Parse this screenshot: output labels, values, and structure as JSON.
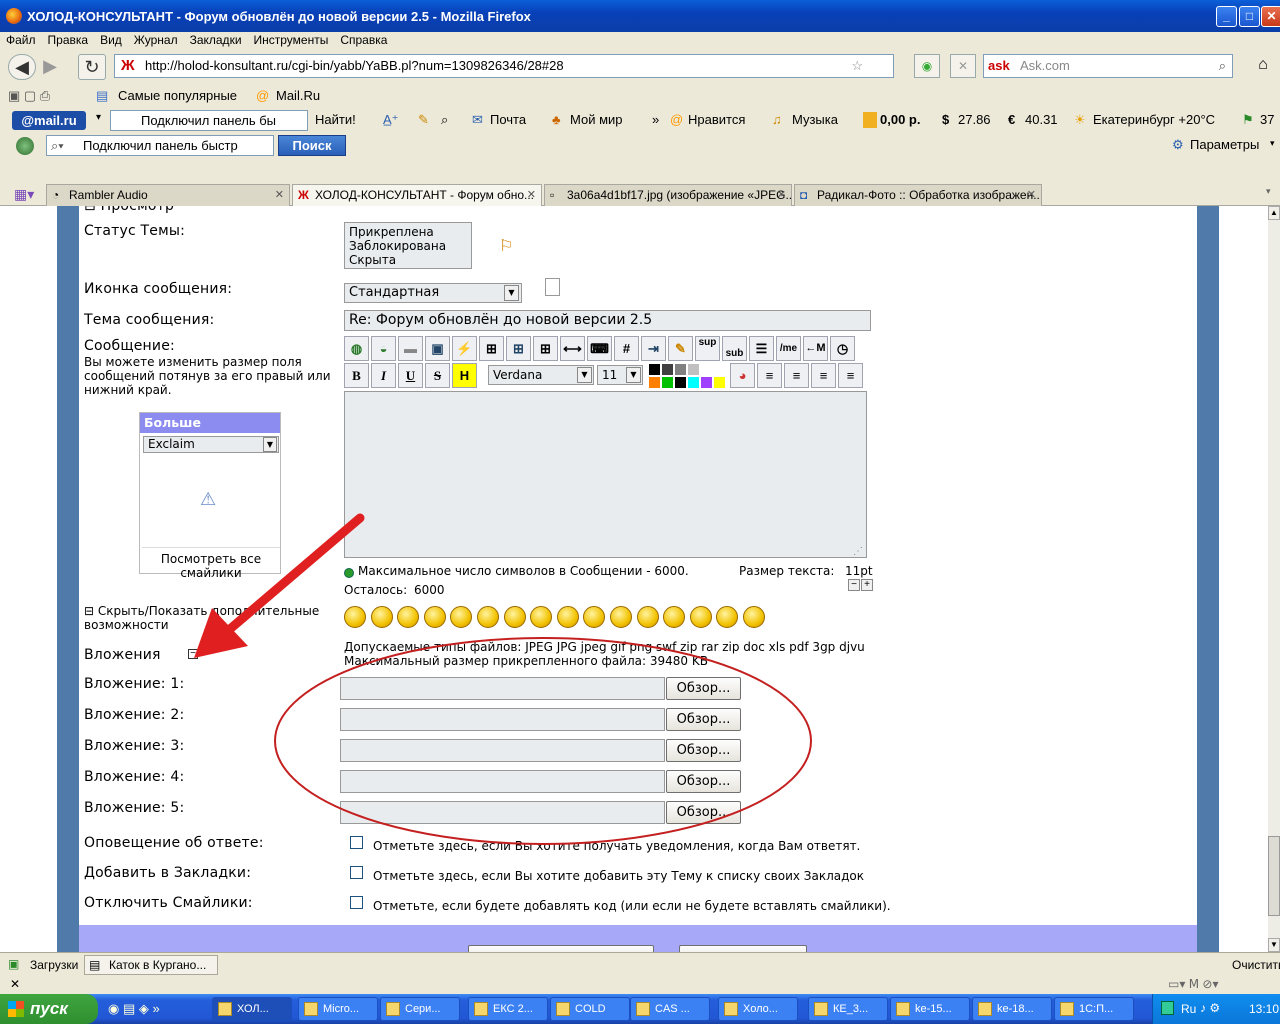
{
  "window": {
    "title": "ХОЛОД-КОНСУЛЬТАНТ - Форум обновлён до новой версии 2.5 - Mozilla Firefox"
  },
  "menu": [
    "Файл",
    "Правка",
    "Вид",
    "Журнал",
    "Закладки",
    "Инструменты",
    "Справка"
  ],
  "nav": {
    "url": "http://holod-konsultant.ru/cgi-bin/yabb/YaBB.pl?num=1309826346/28#28",
    "search_placeholder": "Ask.com"
  },
  "bookmarks": {
    "popular": "Самые популярные",
    "mailru": "Mail.Ru"
  },
  "mailbar": {
    "logo": "@mail.ru",
    "panel_text": "Подключил панель бы",
    "find": "Найти!",
    "mail": "Почта",
    "myworld": "Мой мир",
    "likes": "Нравится",
    "music": "Музыка",
    "money": "0,00 р.",
    "usd": "27.86",
    "eur": "40.31",
    "weather": "Екатеринбург +20°C",
    "traffic": "37"
  },
  "rambler": {
    "search_text": "Подключил панель быстр",
    "search_button": "Поиск",
    "params": "Параметры"
  },
  "tabs": [
    {
      "label": "Rambler Audio"
    },
    {
      "label": "ХОЛОД-КОНСУЛЬТАНТ - Форум обно..."
    },
    {
      "label": "3a06a4d1bf17.jpg (изображение «JPEG..."
    },
    {
      "label": "Радикал-Фото :: Обработка изображен..."
    }
  ],
  "form": {
    "preview": "Просмотр",
    "status_label": "Статус Темы:",
    "status_options": [
      "Прикреплена",
      "Заблокирована",
      "Скрыта"
    ],
    "icon_label": "Иконка сообщения:",
    "icon_value": "Стандартная",
    "subject_label": "Тема сообщения:",
    "subject_value": "Re: Форум обновлён до новой версии 2.5",
    "message_label": "Сообщение:",
    "message_hint": "Вы можете изменить размер поля сообщений потянув за его правый или нижний край.",
    "more_smileys": "Больше смайликов",
    "smiley_set": "Exclaim",
    "view_all_smileys": "Посмотреть все смайлики",
    "font_name": "Verdana",
    "font_size": "11",
    "max_chars": "Максимальное число символов в Сообщении - 6000.",
    "remaining_label": "Осталось:",
    "remaining_value": "6000",
    "text_size_label": "Размер текста:",
    "text_size_value": "11pt",
    "toggle_extra": "Скрыть/Показать дополнительные возможности",
    "attachments_label": "Вложения",
    "allowed_types": "Допускаемые типы файлов: JPEG JPG jpeg gif png swf zip rar zip doc xls pdf 3gp djvu",
    "max_size": "Максимальный размер прикрепленного файла: 39480 KB",
    "attachments": [
      {
        "label": "Вложение: 1:",
        "button": "Обзор..."
      },
      {
        "label": "Вложение: 2:",
        "button": "Обзор..."
      },
      {
        "label": "Вложение: 3:",
        "button": "Обзор..."
      },
      {
        "label": "Вложение: 4:",
        "button": "Обзор..."
      },
      {
        "label": "Вложение: 5:",
        "button": "Обзор..."
      }
    ],
    "notify_label": "Оповещение об ответе:",
    "notify_text": "Отметьте здесь, если Вы хотите получать уведомления, когда Вам ответят.",
    "bookmark_label": "Добавить в Закладки:",
    "bookmark_text": "Отметьте здесь, если Вы хотите добавить эту Тему к списку своих Закладок",
    "nosmile_label": "Отключить Смайлики:",
    "nosmile_text": "Отметьте, если будете добавлять код (или если не будете вставлять смайлики)."
  },
  "toolbar_labels": {
    "sup": "sup",
    "sub": "sub",
    "me": "/me",
    "move": "←M",
    "hash": "#",
    "h": "H",
    "b": "B",
    "i": "I",
    "u": "U",
    "s": "S"
  },
  "statusbar": {
    "downloads": "Загрузки",
    "task": "Каток в Кургано...",
    "clear": "Очистить"
  },
  "taskbar": {
    "start": "пуск",
    "items": [
      "ХОЛ...",
      "Micro...",
      "Сери...",
      "ЕКС 2...",
      "COLD",
      "CAS ...",
      "Холо...",
      "КЕ_3...",
      "ke-15...",
      "ke-18...",
      "1С:П..."
    ],
    "lang": "Ru",
    "clock": "13:10"
  },
  "colors": {
    "accent_blue": "#4f7aaa",
    "arrow_red": "#e02020",
    "ellipse_red": "#c42020",
    "smiley_header": "#8c8cf0"
  }
}
